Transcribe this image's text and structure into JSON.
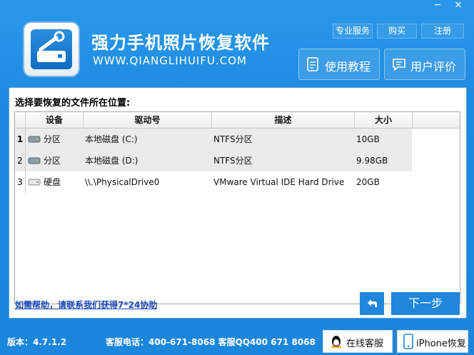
{
  "window": {
    "minimize_icon": "─",
    "close_icon": "✕"
  },
  "header": {
    "title": "强力手机照片恢复软件",
    "url": "WWW.QIANGLIHUIFU.COM",
    "links": [
      "专业服务",
      "购买",
      "注册"
    ],
    "buttons": {
      "tutorial": "使用教程",
      "reviews": "用户评价"
    }
  },
  "panel": {
    "title": "选择要恢复的文件所在位置:",
    "columns": [
      "设备",
      "驱动号",
      "描述",
      "大小"
    ],
    "rows": [
      {
        "num": "1",
        "device": "分区",
        "drive": "本地磁盘 (C:)",
        "desc": "NTFS分区",
        "size": "10GB",
        "icon": "partition-icon"
      },
      {
        "num": "2",
        "device": "分区",
        "drive": "本地磁盘 (D:)",
        "desc": "NTFS分区",
        "size": "9.98GB",
        "icon": "partition-icon"
      },
      {
        "num": "3",
        "device": "硬盘",
        "drive": "\\\\.\\PhysicalDrive0",
        "desc": "VMware Virtual IDE Hard Drive",
        "size": "20GB",
        "icon": "hard-disk-icon"
      }
    ],
    "help_link": "如需帮助，请联系我们获得7*24协助",
    "next_label": "下一步"
  },
  "footer": {
    "version": "版本：4.7.1.2",
    "contact": "客服电话：400-671-8068 客服QQ400 671 8068",
    "online_service": "在线客服",
    "iphone_recovery": "iPhone恢复"
  },
  "colors": {
    "background": "#1e8de0",
    "accent": "#1f86db",
    "link": "#1a49b6"
  }
}
